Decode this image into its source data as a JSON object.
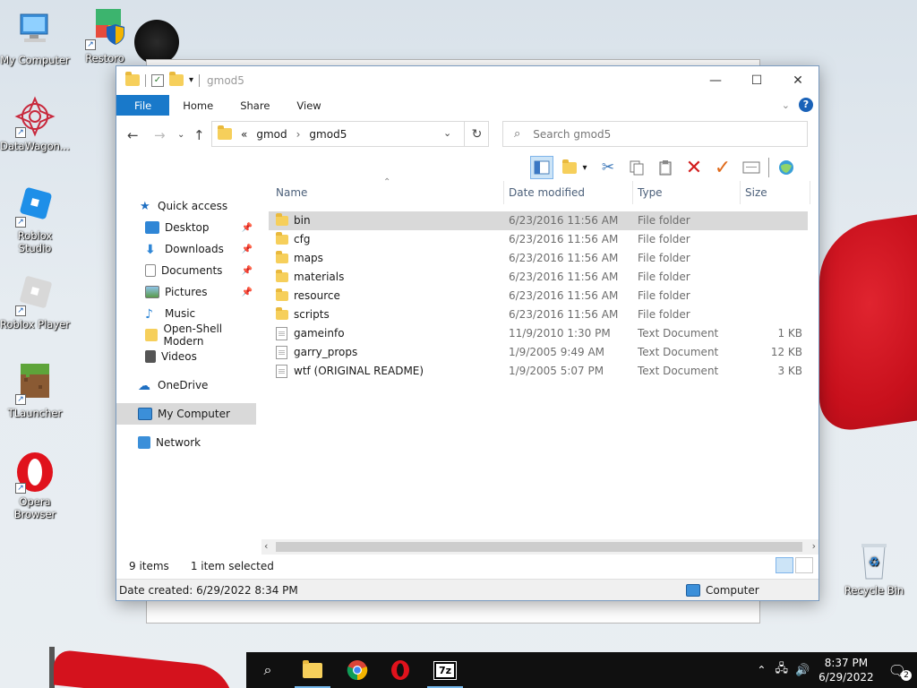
{
  "desktop": {
    "icons": [
      {
        "label": "My Computer"
      },
      {
        "label": "Restoro"
      },
      {
        "label": "DataWagon..."
      },
      {
        "label": "Roblox Studio"
      },
      {
        "label": "Roblox Player"
      },
      {
        "label": "TLauncher"
      },
      {
        "label": "Opera Browser"
      },
      {
        "label": "Recycle Bin"
      }
    ]
  },
  "window": {
    "title": "gmod5",
    "ribbon_tabs": [
      "File",
      "Home",
      "Share",
      "View"
    ],
    "help": "?",
    "address": {
      "prefix": "«",
      "crumbs": [
        "gmod",
        "gmod5"
      ]
    },
    "search_placeholder": "Search gmod5",
    "nav": {
      "quick_access": "Quick access",
      "items": [
        "Desktop",
        "Downloads",
        "Documents",
        "Pictures",
        "Music",
        "Open-Shell Modern",
        "Videos"
      ],
      "onedrive": "OneDrive",
      "my_computer": "My Computer",
      "network": "Network"
    },
    "columns": [
      "Name",
      "Date modified",
      "Type",
      "Size"
    ],
    "files": [
      {
        "name": "bin",
        "date": "6/23/2016 11:56 AM",
        "type": "File folder",
        "size": "",
        "kind": "folder"
      },
      {
        "name": "cfg",
        "date": "6/23/2016 11:56 AM",
        "type": "File folder",
        "size": "",
        "kind": "folder"
      },
      {
        "name": "maps",
        "date": "6/23/2016 11:56 AM",
        "type": "File folder",
        "size": "",
        "kind": "folder"
      },
      {
        "name": "materials",
        "date": "6/23/2016 11:56 AM",
        "type": "File folder",
        "size": "",
        "kind": "folder"
      },
      {
        "name": "resource",
        "date": "6/23/2016 11:56 AM",
        "type": "File folder",
        "size": "",
        "kind": "folder"
      },
      {
        "name": "scripts",
        "date": "6/23/2016 11:56 AM",
        "type": "File folder",
        "size": "",
        "kind": "folder"
      },
      {
        "name": "gameinfo",
        "date": "11/9/2010 1:30 PM",
        "type": "Text Document",
        "size": "1 KB",
        "kind": "text"
      },
      {
        "name": "garry_props",
        "date": "1/9/2005 9:49 AM",
        "type": "Text Document",
        "size": "12 KB",
        "kind": "text"
      },
      {
        "name": "wtf (ORIGINAL README)",
        "date": "1/9/2005 5:07 PM",
        "type": "Text Document",
        "size": "3 KB",
        "kind": "text"
      }
    ],
    "status": {
      "count": "9 items",
      "selected": "1 item selected"
    },
    "details": {
      "created": "Date created: 6/29/2022 8:34 PM",
      "location": "Computer"
    }
  },
  "taskbar": {
    "time": "8:37 PM",
    "date": "6/29/2022",
    "notifications": "2",
    "apps": [
      "search-icon",
      "file-explorer-icon",
      "chrome-icon",
      "opera-icon",
      "7zip-icon"
    ],
    "sevenzip_label": "7z"
  },
  "colors": {
    "accent": "#1979ca",
    "selection": "#d9d9d9",
    "taskbar": "#101010"
  }
}
